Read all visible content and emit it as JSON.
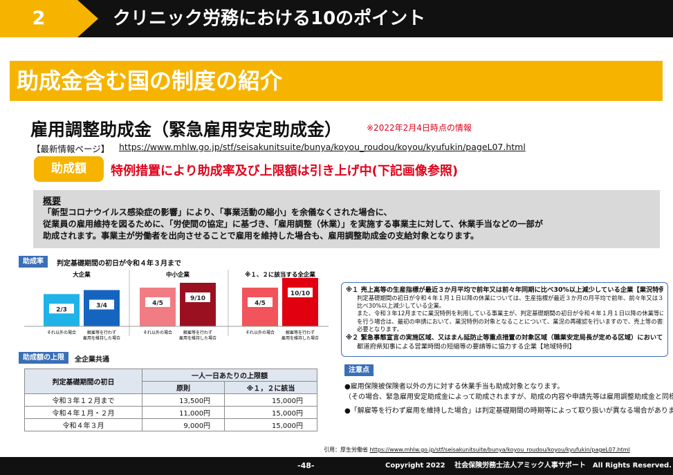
{
  "header": {
    "section_number": "2",
    "section_title": "クリニック労務における10のポイント"
  },
  "banner": {
    "title": "助成金含む国の制度の紹介"
  },
  "subsidy": {
    "title": "雇用調整助成金（緊急雇用安定助成金）",
    "as_of_note": "※2022年2月4日時点の情報",
    "info_label": "【最新情報ページ】",
    "info_url": "https://www.mhlw.go.jp/stf/seisakunitsuite/bunya/koyou_roudou/koyou/kyufukin/pageL07.html"
  },
  "amount": {
    "badge": "助成額",
    "text": "特例措置により助成率及び上限額は引き上げ中(下記画像参照)"
  },
  "overview": {
    "heading": "概要",
    "lines": [
      "「新型コロナウイルス感染症の影響」により、「事業活動の縮小」を余儀なくされた場合に、",
      "従業員の雇用維持を図るために、「労使間の協定」に基づき、「雇用調整（休業）」を実施する事業主に対して、休業手当などの一部が",
      "助成されます。事業主が労働者を出向させることで雇用を維持した場合も、雇用調整助成金の支給対象となります。"
    ]
  },
  "rate_section": {
    "tag": "助成率",
    "heading": "判定基礎期間の初日が令和４年３月まで"
  },
  "chart_data": {
    "type": "bar",
    "groups": [
      "大企業",
      "中小企業",
      "※１、２に該当する全企業"
    ],
    "series": [
      {
        "name": "それ以外の場合",
        "values": [
          "2/3",
          "4/5",
          "4/5"
        ],
        "color": "#1fb3e8"
      },
      {
        "name": "解雇等を行わず雇用を維持した場合",
        "values": [
          "3/4",
          "9/10",
          "10/10"
        ],
        "color": "#1565c0"
      }
    ],
    "alt_colors": {
      "mid_other": "#f27c84",
      "mid_keep": "#9b1020",
      "all_other": "#f2545b",
      "all_keep": "#e00010"
    },
    "left_label": "それ以外の場合",
    "right_label_1": "解雇等を行わず",
    "right_label_2": "雇用を維持した場合"
  },
  "limit_section": {
    "tag": "助成額の上限",
    "heading": "全企業共通",
    "col_period": "判定基礎期間の初日",
    "col_daily": "一人一日あたりの上限額",
    "col_principle": "原則",
    "col_special": "※１，２に該当",
    "rows": [
      {
        "period": "令和３年１２月まで",
        "principle": "13,500円",
        "special": "15,000円"
      },
      {
        "period": "令和４年１月・２月",
        "principle": "11,000円",
        "special": "15,000円"
      },
      {
        "period": "令和４年３月",
        "principle": "9,000円",
        "special": "15,000円"
      }
    ]
  },
  "notes": {
    "n1_head": "※１ 売上高等の生産指標が最近３か月平均で前年又は前々年同期に比べ30%以上減少している企業【業況特例】",
    "n1_lines": [
      "判定基礎期間の初日が令和４年１月１日以降の休業については、生産指標が最近３か月の月平均で前年、前々年又は３年前同期に",
      "比べ30%以上減少している企業。",
      "また、令和３年12月までに業況特例を利用している事業主が、判定基礎期間の初日が令和４年１月１日以降の休業等について申請",
      "を行う場合は、最初の申請において、業況特例の対象となることについて、業況の再確認を行いますので、売上等の書類の再提出が",
      "必要となります。"
    ],
    "n2_head": "※２ 緊急事態宣言の実施区域、又はまん延防止等重点措置の対象区域（職業安定局長が定める区域）において",
    "n2_line": "都道府県知事による営業時間の短縮等の要請等に協力する企業【地域特例】"
  },
  "caution": {
    "tag": "注意点",
    "l1": "●雇用保険被保険者以外の方に対する休業手当も助成対象となります。",
    "l2": "（その場合、緊急雇用安定助成金によって助成されますが、助成の内容や申請先等は雇用調整助成金と同様です。）",
    "l3": "●「解雇等を行わず雇用を維持した場合」は判定基礎期間の時期等によって取り扱いが異なる場合があります。"
  },
  "citation": {
    "label": "引用：厚生労働省 ",
    "url": "https://www.mhlw.go.jp/stf/seisakunitsuite/bunya/koyou_roudou/koyou/kyufukin/pageL07.html"
  },
  "footer": {
    "page": "-48-",
    "copyright": "Copyright 2022　 社会保険労務士法人アミック人事サポート　All Rights Reserved."
  }
}
